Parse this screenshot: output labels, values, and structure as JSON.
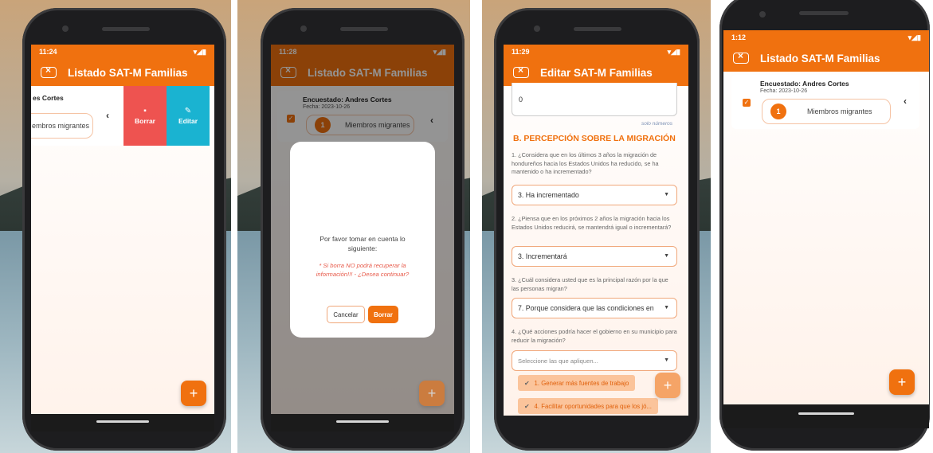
{
  "colors": {
    "accent": "#f0710f",
    "delete_red": "#ee5350",
    "edit_cyan": "#1ab3d1"
  },
  "phones": [
    {
      "time": "11:24",
      "title": "Listado SAT-M Familias",
      "card": {
        "encuestado_partial": "es Cortes",
        "member_partial": "embros migrantes"
      },
      "swipe": {
        "delete_label": "Borrar",
        "edit_label": "Editar",
        "delete_icon": "trash-icon",
        "edit_icon": "edit-icon"
      },
      "fab": "+"
    },
    {
      "time": "11:28",
      "title": "Listado SAT-M Familias",
      "card": {
        "encuestado": "Encuestado: Andres Cortes",
        "fecha": "Fecha: 2023-10-26",
        "count": "1",
        "member": "Miembros migrantes"
      },
      "dialog": {
        "message": "Por favor tomar en cuenta lo siguiente:",
        "warning": "* Si borra NO podrá recuperar la información!!! - ¿Desea continuar?",
        "cancel": "Cancelar",
        "confirm": "Borrar"
      },
      "fab": "+"
    },
    {
      "time": "11:29",
      "title": "Editar SAT-M Familias",
      "form": {
        "top_value": "0",
        "helper": "solo números",
        "section": "B. PERCEPCIÓN SOBRE LA MIGRACIÓN",
        "q1": "1. ¿Considera que en los últimos 3 años la migración de hondureños hacia los Estados Unidos ha reducido, se ha mantenido o ha incrementado?",
        "a1": "3. Ha incrementado",
        "q2": "2. ¿Piensa que en los próximos 2 años la migración hacia los Estados Unidos reducirá, se mantendrá igual o incrementará?",
        "a2": "3. Incrementará",
        "q3": "3. ¿Cuál considera usted que es la principal razón por la que las personas migran?",
        "a3": "7. Porque considera que las condiciones en",
        "q4": "4. ¿Qué acciones podría hacer el gobierno en su municipio para reducir la migración?",
        "a4_placeholder": "Seleccione las que apliquen...",
        "chip1": "1. Generar más fuentes de trabajo",
        "chip2": "4. Facilitar oportunidades para que los jó..."
      },
      "fab": "+"
    },
    {
      "time": "1:12",
      "title": "Listado SAT-M Familias",
      "card": {
        "encuestado": "Encuestado: Andres Cortes",
        "fecha": "Fecha: 2023-10-26",
        "count": "1",
        "member": "Miembros migrantes"
      },
      "fab": "+"
    }
  ]
}
